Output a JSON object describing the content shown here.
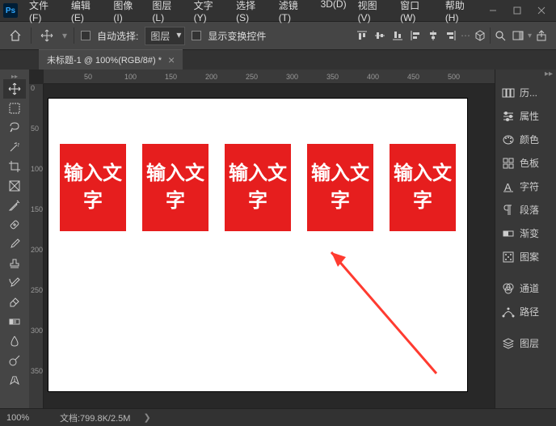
{
  "titlebar": {
    "logo": "Ps",
    "menus": [
      "文件(F)",
      "编辑(E)",
      "图像(I)",
      "图层(L)",
      "文字(Y)",
      "选择(S)",
      "滤镜(T)",
      "3D(D)",
      "视图(V)",
      "窗口(W)",
      "帮助(H)"
    ]
  },
  "options": {
    "auto_select_label": "自动选择:",
    "dropdown_value": "图层",
    "show_transform_label": "显示变换控件"
  },
  "tab": {
    "title": "未标题-1 @ 100%(RGB/8#) *"
  },
  "ruler_h": [
    "50",
    "100",
    "150",
    "200",
    "250",
    "300",
    "350",
    "400",
    "450",
    "500"
  ],
  "ruler_v": [
    "0",
    "50",
    "100",
    "150",
    "200",
    "250",
    "300",
    "350"
  ],
  "canvas": {
    "box_text": "输入文字",
    "box_positions": [
      14,
      116,
      218,
      320,
      422
    ]
  },
  "panels": {
    "items": [
      {
        "icon": "history",
        "label": "历..."
      },
      {
        "icon": "properties",
        "label": "属性"
      },
      {
        "icon": "color",
        "label": "颜色"
      },
      {
        "icon": "swatches",
        "label": "色板"
      },
      {
        "icon": "character",
        "label": "字符"
      },
      {
        "icon": "paragraph",
        "label": "段落"
      },
      {
        "icon": "gradient",
        "label": "渐变"
      },
      {
        "icon": "pattern",
        "label": "图案"
      },
      {
        "sep": true
      },
      {
        "icon": "channels",
        "label": "通道"
      },
      {
        "icon": "paths",
        "label": "路径"
      },
      {
        "sep": true
      },
      {
        "icon": "layers",
        "label": "图层"
      }
    ]
  },
  "statusbar": {
    "zoom": "100%",
    "doc_info": "文档:799.8K/2.5M"
  }
}
